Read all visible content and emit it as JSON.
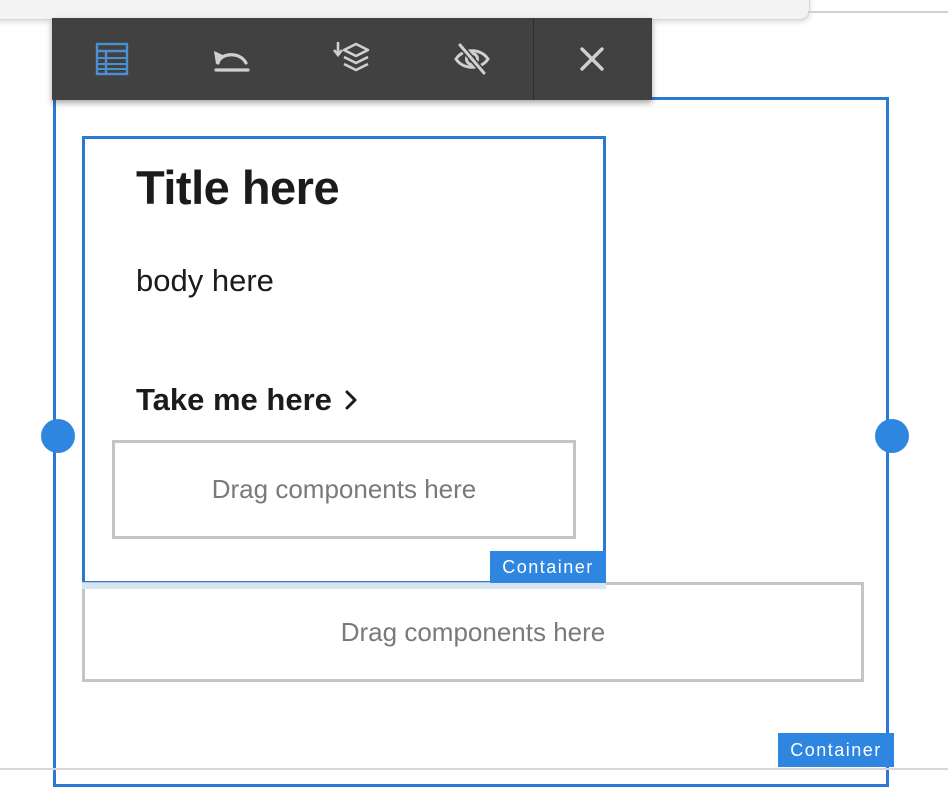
{
  "toolbar": {
    "tools": [
      {
        "icon": "layout-table-icon",
        "action": "configure"
      },
      {
        "icon": "undo-icon",
        "action": "undo"
      },
      {
        "icon": "layers-sort-icon",
        "action": "layers"
      },
      {
        "icon": "visibility-off-icon",
        "action": "hide"
      },
      {
        "icon": "close-icon",
        "action": "close"
      }
    ]
  },
  "content": {
    "title": "Title here",
    "body": "body here",
    "cta_label": "Take me here"
  },
  "drop_zones": {
    "inner": "Drag components here",
    "outer": "Drag components here"
  },
  "labels": {
    "inner_container": "Container",
    "outer_container": "Container"
  },
  "colors": {
    "accent": "#2b79d6",
    "handle": "#2f86e0",
    "toolbar_bg": "#414141",
    "active_tool_icon": "#4d8fd3"
  }
}
